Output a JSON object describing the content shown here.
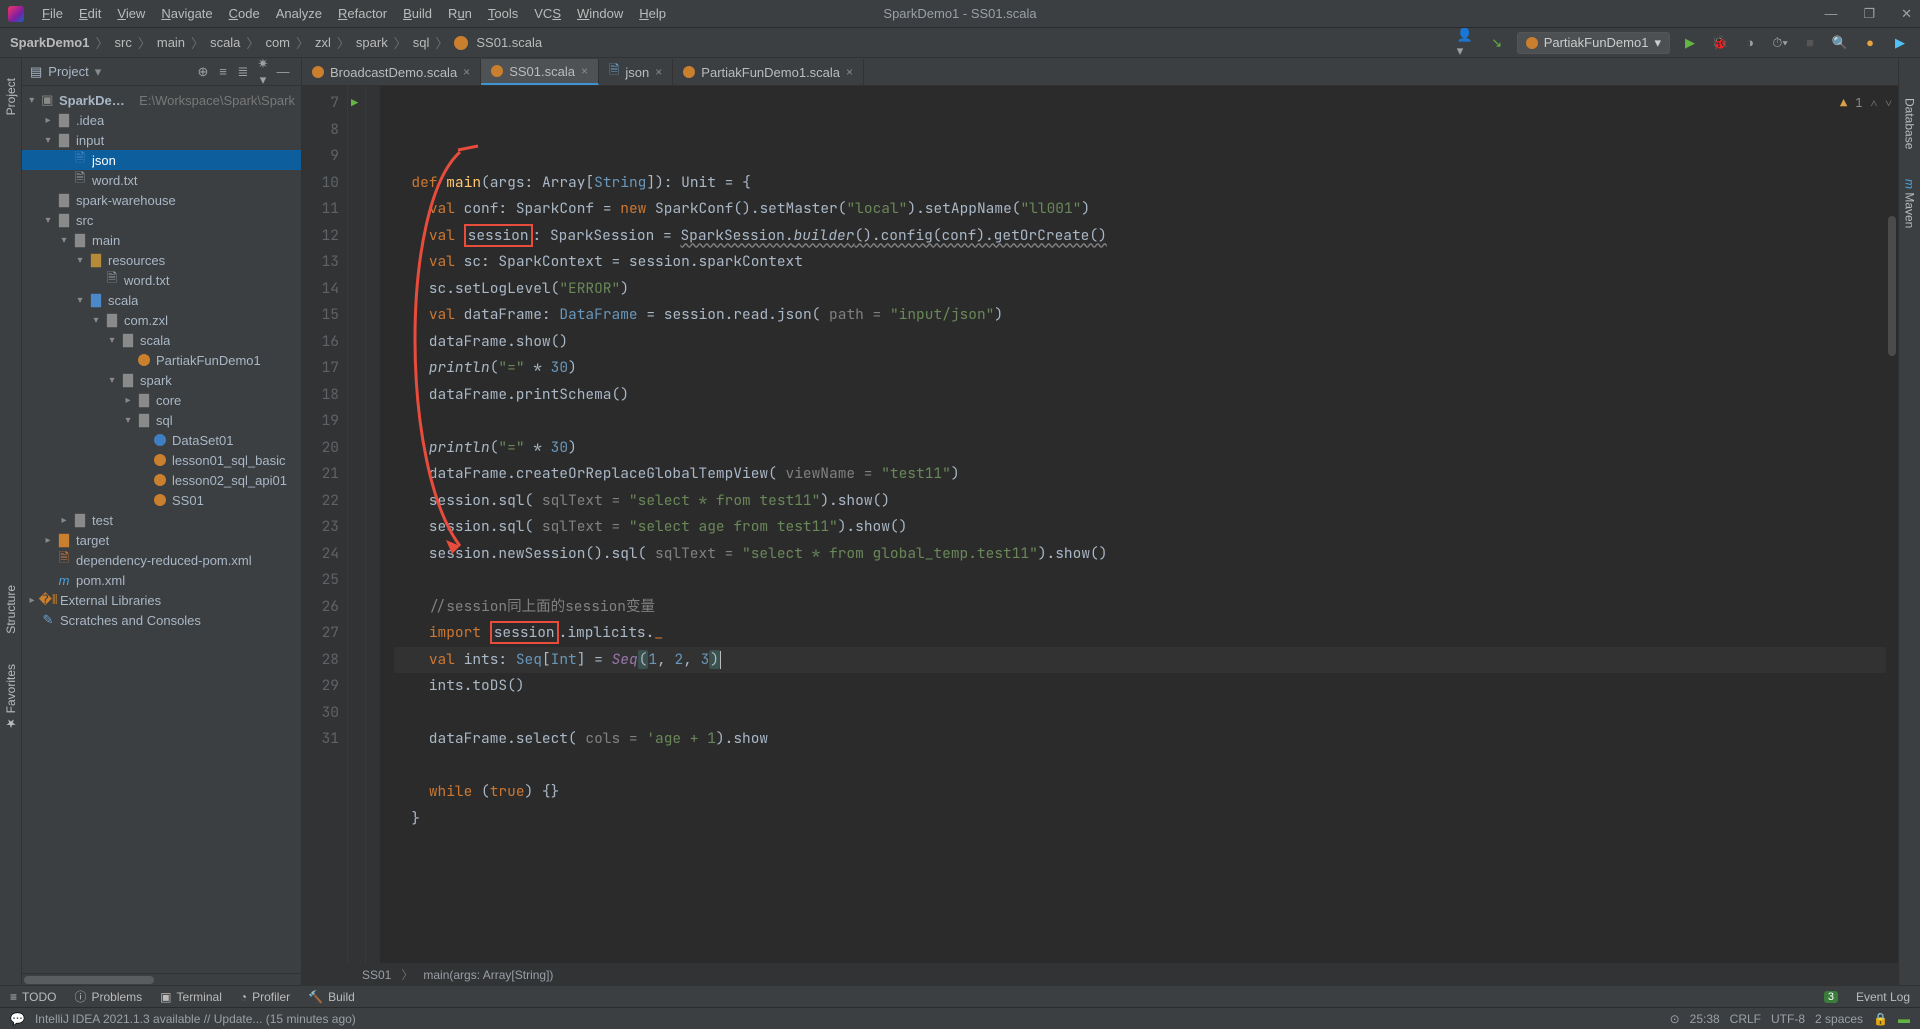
{
  "window_title": "SparkDemo1 - SS01.scala",
  "menu": {
    "file": "File",
    "edit": "Edit",
    "view": "View",
    "navigate": "Navigate",
    "code": "Code",
    "analyze": "Analyze",
    "refactor": "Refactor",
    "build": "Build",
    "run": "Run",
    "tools": "Tools",
    "vcs": "VCS",
    "window": "Window",
    "help": "Help"
  },
  "breadcrumbs": [
    "SparkDemo1",
    "src",
    "main",
    "scala",
    "com",
    "zxl",
    "spark",
    "sql",
    "SS01.scala"
  ],
  "run_config": "PartiakFunDemo1",
  "left_tool_tabs": [
    "Project",
    "Structure",
    "Favorites"
  ],
  "right_tool_tabs": [
    "Database",
    "Maven"
  ],
  "project_header": "Project",
  "project_root_hint": "E:\\Workspace\\Spark\\Spark",
  "tree": {
    "root": "SparkDemo1",
    "idea": ".idea",
    "input": "input",
    "json": "json",
    "wordtxt": "word.txt",
    "spark_warehouse": "spark-warehouse",
    "src": "src",
    "main_dir": "main",
    "resources": "resources",
    "wordtxt2": "word.txt",
    "scala": "scala",
    "comzxl": "com.zxl",
    "scala2": "scala",
    "partiak": "PartiakFunDemo1",
    "spark": "spark",
    "core": "core",
    "sql": "sql",
    "dataset01": "DataSet01",
    "lesson01": "lesson01_sql_basic",
    "lesson02": "lesson02_sql_api01",
    "ss01": "SS01",
    "test": "test",
    "target": "target",
    "deppom": "dependency-reduced-pom.xml",
    "pom": "pom.xml",
    "extlib": "External Libraries",
    "scratches": "Scratches and Consoles"
  },
  "tabs": [
    {
      "label": "BroadcastDemo.scala",
      "active": false,
      "icon": "scala"
    },
    {
      "label": "SS01.scala",
      "active": true,
      "icon": "scala"
    },
    {
      "label": "json",
      "active": false,
      "icon": "json"
    },
    {
      "label": "PartiakFunDemo1.scala",
      "active": false,
      "icon": "scala"
    }
  ],
  "line_start": 7,
  "line_end": 31,
  "code_lines": [
    {
      "n": 7,
      "html": "  <span class='kw'>def</span> <span class='fn'>main</span>(args: <span class='ty'>Array</span>[<span class='ty' style='color:#6897bb'>String</span>]): <span class='ty'>Unit</span> = {"
    },
    {
      "n": 8,
      "html": "    <span class='kw'>val</span> conf: <span class='ty'>SparkConf</span> = <span class='kw'>new</span> SparkConf().setMaster(<span class='str'>\"local\"</span>).setAppName(<span class='str'>\"ll001\"</span>)"
    },
    {
      "n": 9,
      "html": "    <span class='kw'>val</span> <span class='boxed'>session</span>: <span class='ty'>SparkSession</span> = <span class='wavy'>SparkSession.<span class='it'>builder</span>().config(conf).getOrCreate()</span>"
    },
    {
      "n": 10,
      "html": "    <span class='kw'>val</span> sc: <span class='ty'>SparkContext</span> = session.sparkContext"
    },
    {
      "n": 11,
      "html": "    sc.setLogLevel(<span class='str'>\"ERROR\"</span>)"
    },
    {
      "n": 12,
      "html": "    <span class='kw'>val</span> dataFrame: <span class='ty' style='color:#6897bb'>DataFrame</span> = session.read.json( <span class='param'>path =</span> <span class='str'>\"input/json\"</span>)"
    },
    {
      "n": 13,
      "html": "    dataFrame.show()"
    },
    {
      "n": 14,
      "html": "    <span class='it'>println</span>(<span class='str'>\"=\"</span> * <span class='num'>30</span>)"
    },
    {
      "n": 15,
      "html": "    dataFrame.printSchema()"
    },
    {
      "n": 16,
      "html": ""
    },
    {
      "n": 17,
      "html": "    <span class='it'>println</span>(<span class='str'>\"=\"</span> * <span class='num'>30</span>)"
    },
    {
      "n": 18,
      "html": "    dataFrame.createOrReplaceGlobalTempView( <span class='param'>viewName =</span> <span class='str'>\"test11\"</span>)"
    },
    {
      "n": 19,
      "html": "    session.sql( <span class='param'>sqlText =</span> <span class='str'>\"select * from test11\"</span>).show()"
    },
    {
      "n": 20,
      "html": "    session.sql( <span class='param'>sqlText =</span> <span class='str'>\"select age from test11\"</span>).show()"
    },
    {
      "n": 21,
      "html": "    session.newSession().sql( <span class='param'>sqlText =</span> <span class='str'>\"select * from global_temp.test11\"</span>).show()"
    },
    {
      "n": 22,
      "html": ""
    },
    {
      "n": 23,
      "html": "    <span class='cm'>//session同上面的session变量</span>"
    },
    {
      "n": 24,
      "html": "    <span class='kw'>import</span> <span class='boxed'>session</span>.implicits.<span style='color:#cc7832'>_</span>"
    },
    {
      "n": 25,
      "html": "    <span class='kw'>val</span> ints: <span class='ty' style='color:#6897bb'>Seq</span>[<span class='ty' style='color:#6897bb'>Int</span>] = <span class='it' style='color:#9876aa'>Seq</span><span class='bracket-hl'>(</span><span class='num'>1</span>, <span class='num'>2</span>, <span class='num'>3</span><span class='bracket-hl'>)</span><span class='caret'></span>",
      "hl": true
    },
    {
      "n": 26,
      "html": "    ints.toDS()"
    },
    {
      "n": 27,
      "html": ""
    },
    {
      "n": 28,
      "html": "    dataFrame.select( <span class='param'>cols =</span> <span class='str'>'age + 1</span>).show"
    },
    {
      "n": 29,
      "html": ""
    },
    {
      "n": 30,
      "html": "    <span class='kw'>while</span> (<span class='kw'>true</span>) {}"
    },
    {
      "n": 31,
      "html": "  }"
    }
  ],
  "warning_count": "1",
  "editor_breadcrumb": [
    "SS01",
    "main(args: Array[String])"
  ],
  "bottom_tabs": {
    "todo": "TODO",
    "problems": "Problems",
    "terminal": "Terminal",
    "profiler": "Profiler",
    "build": "Build",
    "eventlog": "Event Log",
    "badge": "3"
  },
  "status": {
    "update": "IntelliJ IDEA 2021.1.3 available // Update... (15 minutes ago)",
    "pos": "25:38",
    "lineend": "CRLF",
    "encoding": "UTF-8",
    "indent": "2 spaces"
  }
}
